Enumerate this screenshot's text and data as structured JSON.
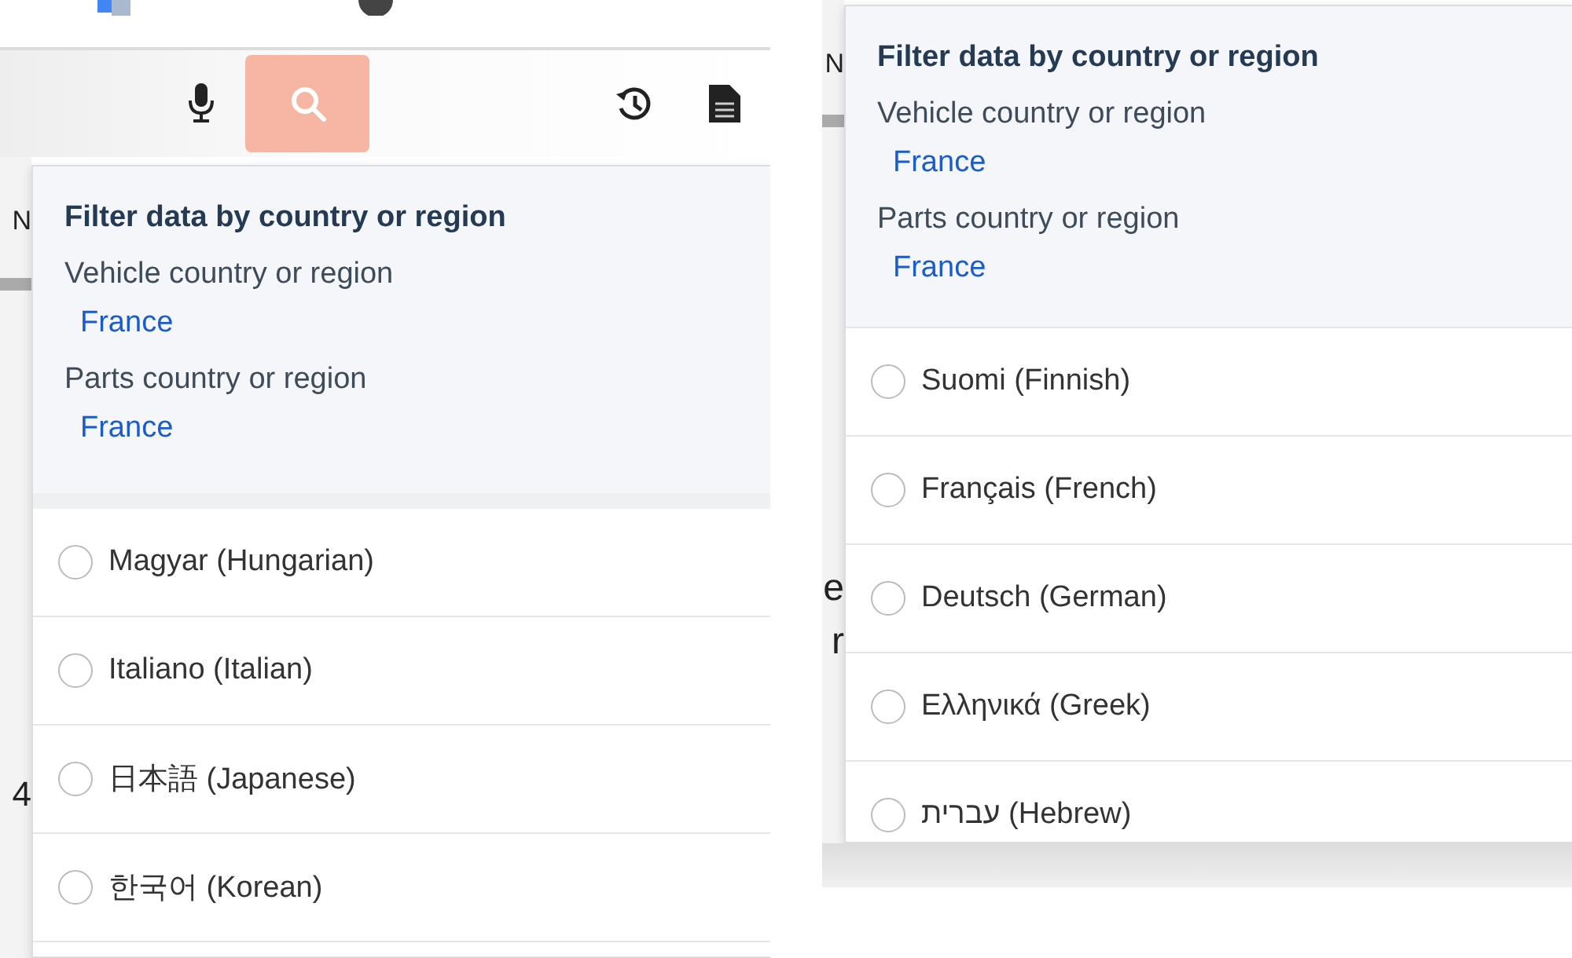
{
  "left_view": {
    "page_fragments": [
      {
        "text": "N"
      },
      {
        "text": "4"
      }
    ],
    "filter": {
      "title": "Filter data by country or region",
      "fields": [
        {
          "label": "Vehicle country or region",
          "value": "France"
        },
        {
          "label": "Parts country or region",
          "value": "France"
        }
      ]
    },
    "languages": [
      {
        "label": "Magyar (Hungarian)",
        "selected": false
      },
      {
        "label": "Italiano (Italian)",
        "selected": false
      },
      {
        "label": "日本語 (Japanese)",
        "selected": false
      },
      {
        "label": "한국어 (Korean)",
        "selected": false
      }
    ]
  },
  "right_view": {
    "page_fragments": [
      {
        "text": "N"
      },
      {
        "text": "e"
      },
      {
        "text": "r"
      }
    ],
    "filter": {
      "title": "Filter data by country or region",
      "fields": [
        {
          "label": "Vehicle country or region",
          "value": "France"
        },
        {
          "label": "Parts country or region",
          "value": "France"
        }
      ]
    },
    "languages": [
      {
        "label": "Suomi (Finnish)",
        "selected": false
      },
      {
        "label": "Français (French)",
        "selected": false
      },
      {
        "label": "Deutsch (German)",
        "selected": false
      },
      {
        "label": "Ελληνικά (Greek)",
        "selected": false
      },
      {
        "label": "עברית (Hebrew)",
        "selected": false
      }
    ]
  }
}
